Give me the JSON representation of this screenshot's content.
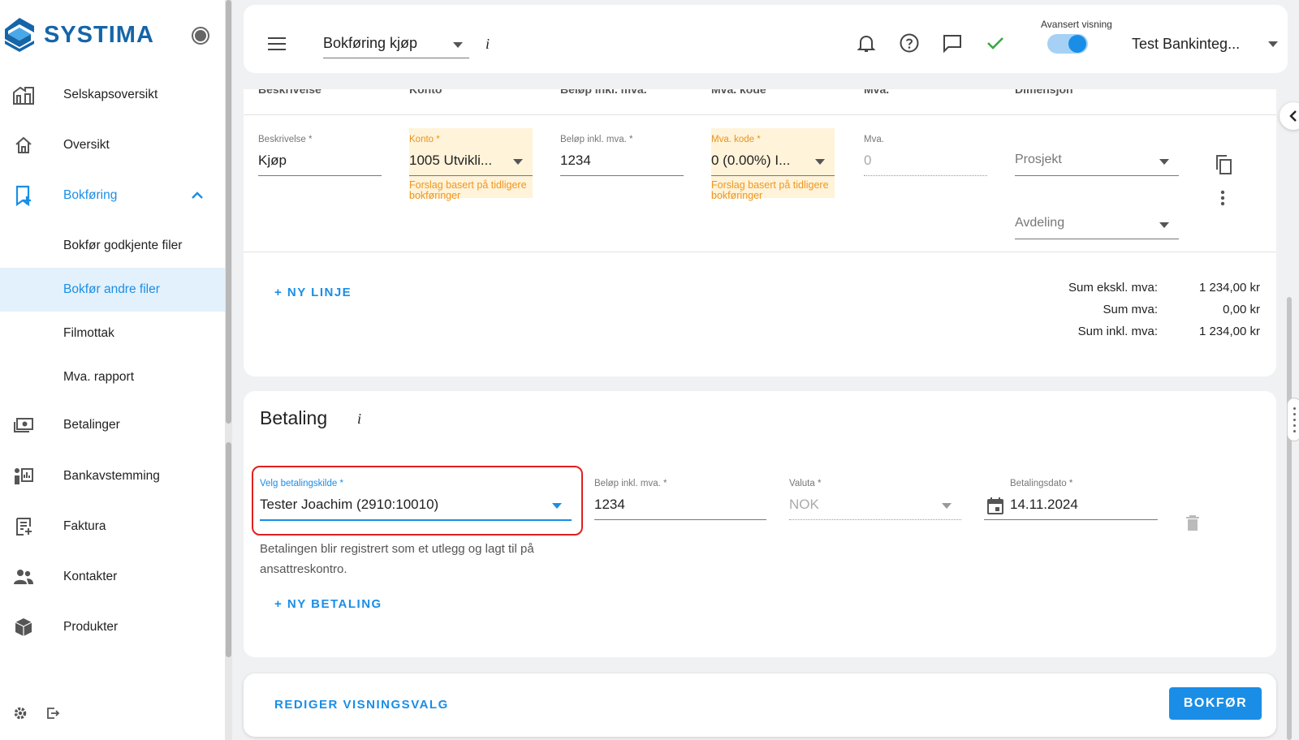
{
  "app": {
    "brand": "SYSTIMA"
  },
  "sidebar": {
    "items": [
      {
        "label": "Selskapsoversikt",
        "icon": "buildings-icon"
      },
      {
        "label": "Oversikt",
        "icon": "home-icon"
      },
      {
        "label": "Bokføring",
        "icon": "bookmark-plus-icon",
        "expanded": true
      },
      {
        "label": "Bokfør godkjente filer"
      },
      {
        "label": "Bokfør andre filer",
        "selected": true
      },
      {
        "label": "Filmottak"
      },
      {
        "label": "Mva. rapport"
      },
      {
        "label": "Betalinger",
        "icon": "cash-icon"
      },
      {
        "label": "Bankavstemming",
        "icon": "reconcile-icon"
      },
      {
        "label": "Faktura",
        "icon": "invoice-icon"
      },
      {
        "label": "Kontakter",
        "icon": "people-icon"
      },
      {
        "label": "Produkter",
        "icon": "box-icon"
      }
    ]
  },
  "topbar": {
    "page_title": "Bokføring kjøp",
    "info": "i",
    "advanced_label": "Avansert visning",
    "advanced_on": true,
    "company": "Test Bankinteg..."
  },
  "lines": {
    "headers": [
      "Beskrivelse",
      "Konto",
      "Beløp inkl. mva.",
      "Mva. kode",
      "Mva.",
      "Dimensjon"
    ],
    "row": {
      "description_label": "Beskrivelse *",
      "description": "Kjøp",
      "account_label": "Konto *",
      "account": "1005 Utvikli...",
      "account_hint": "Forslag basert på tidligere bokføringer",
      "amount_label": "Beløp inkl. mva. *",
      "amount": "1234",
      "vat_code_label": "Mva. kode *",
      "vat_code": "0 (0.00%) I...",
      "vat_code_hint": "Forslag basert på tidligere bokføringer",
      "vat_label": "Mva.",
      "vat": "0",
      "project_placeholder": "Prosjekt",
      "department_placeholder": "Avdeling"
    },
    "new_line": "+ NY LINJE",
    "sums": [
      {
        "label": "Sum ekskl. mva:",
        "value": "1 234,00 kr"
      },
      {
        "label": "Sum mva:",
        "value": "0,00 kr"
      },
      {
        "label": "Sum inkl. mva:",
        "value": "1 234,00 kr"
      }
    ]
  },
  "payment": {
    "title": "Betaling",
    "info": "i",
    "source_label": "Velg betalingskilde *",
    "source": "Tester Joachim (2910:10010)",
    "amount_label": "Beløp inkl. mva. *",
    "amount": "1234",
    "currency_label": "Valuta *",
    "currency": "NOK",
    "date_label": "Betalingsdato *",
    "date": "14.11.2024",
    "note": "Betalingen blir registrert som et utlegg og lagt til på ansattreskontro.",
    "new_payment": "+ NY BETALING"
  },
  "footer": {
    "edit_view": "REDIGER VISNINGSVALG",
    "post": "BOKFØR"
  },
  "colors": {
    "accent": "#1a8ee6",
    "brand": "#1565a8",
    "highlight": "#e02020",
    "suggest_bg": "#fff3d9",
    "suggest_text": "#f0961e"
  }
}
